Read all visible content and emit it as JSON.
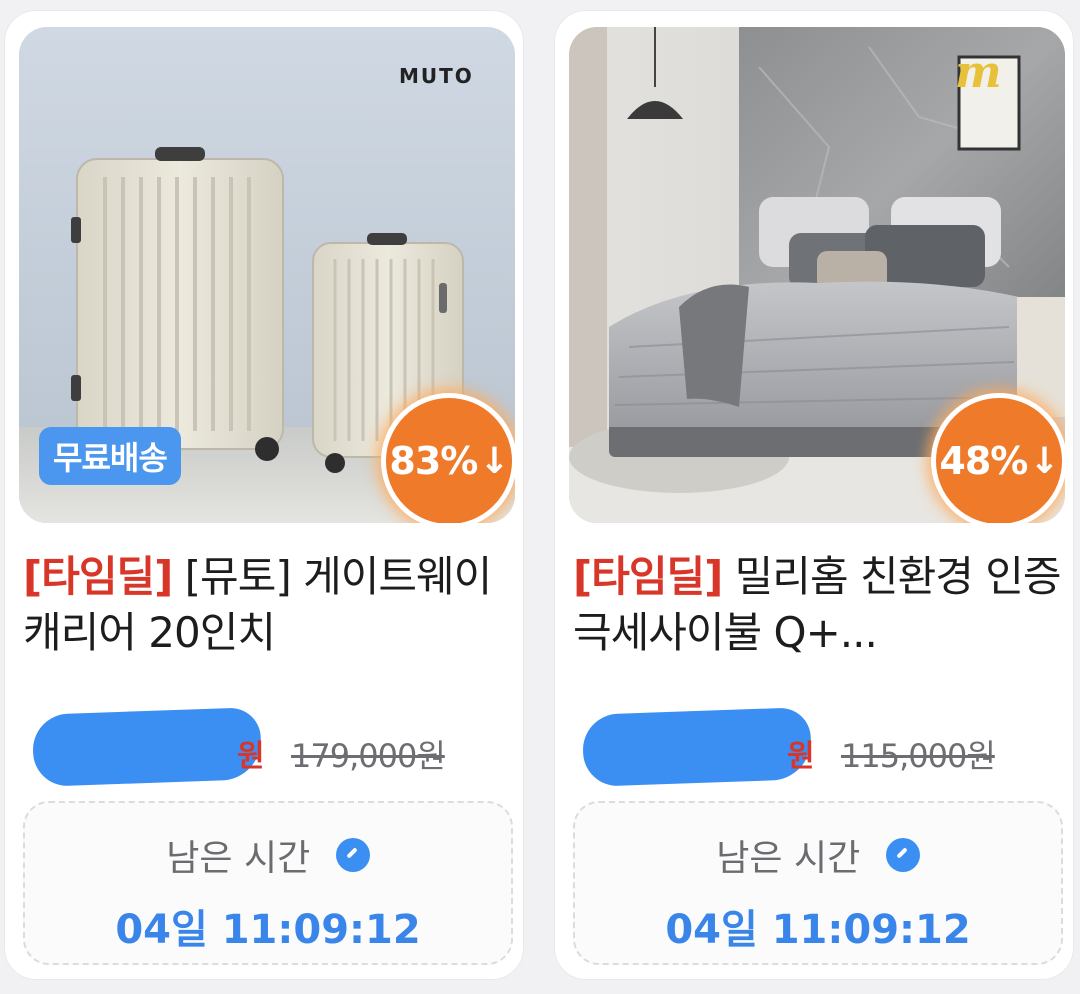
{
  "products": [
    {
      "brand_logo": "MUTO",
      "discount": "83%",
      "discount_arrow": "↓",
      "badge": "무료배송",
      "deal_tag": "[타임딜]",
      "title": " [뮤토] 게이트웨이 캐리어 20인치",
      "price_unit": "원",
      "original_price": "179,000원",
      "timer_label": "남은 시간",
      "countdown": "04일 11:09:12"
    },
    {
      "discount": "48%",
      "discount_arrow": "↓",
      "deal_tag": "[타임딜]",
      "title": " 밀리홈 친환경 인증 극세사이불 Q+...",
      "price_unit": "원",
      "original_price": "115,000원",
      "timer_label": "남은 시간",
      "countdown": "04일 11:09:12"
    }
  ],
  "colors": {
    "deal_red": "#d9362a",
    "discount_orange": "#ee7a2a",
    "accent_blue": "#3b8ff3"
  },
  "icons": {
    "timer": "clock-icon",
    "discount": "arrow-down-icon"
  }
}
